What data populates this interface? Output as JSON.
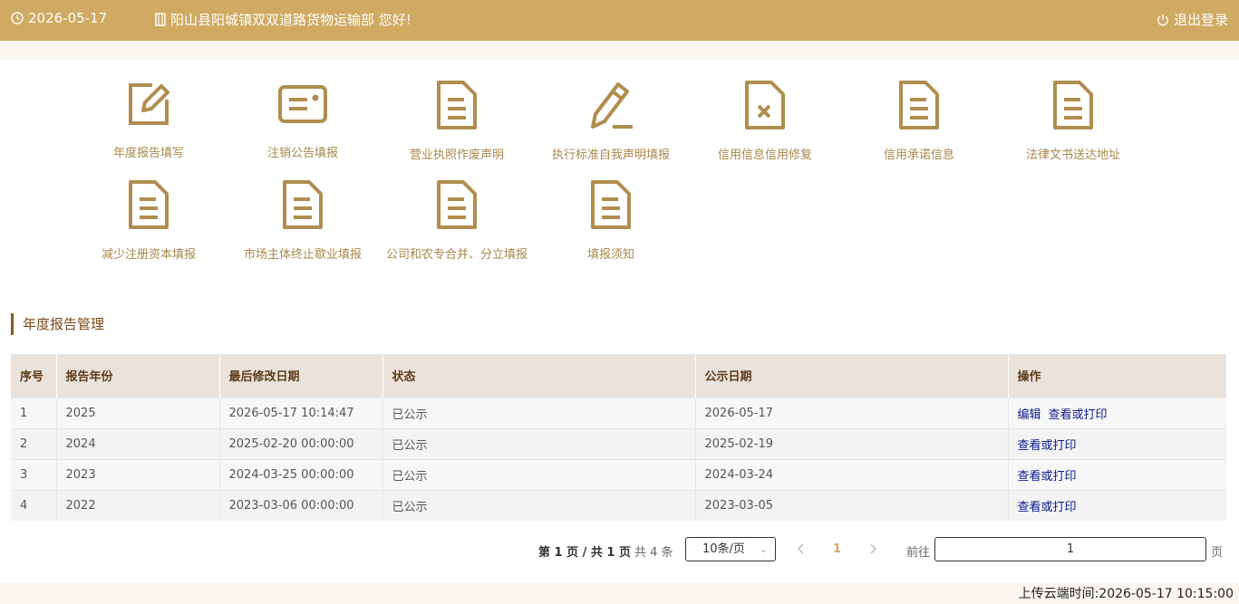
{
  "header": {
    "date": "2026-05-17",
    "greeting": "阳山县阳城镇双双道路货物运输部 您好!",
    "logout_label": "退出登录"
  },
  "menu": [
    {
      "label": "年度报告填写",
      "icon": "edit-icon"
    },
    {
      "label": "注销公告填报",
      "icon": "id-card-icon"
    },
    {
      "label": "营业执照作废声明",
      "icon": "document-icon"
    },
    {
      "label": "执行标准自我声明填报",
      "icon": "pencil-icon"
    },
    {
      "label": "信用信息信用修复",
      "icon": "document-x-icon"
    },
    {
      "label": "信用承诺信息",
      "icon": "document-icon"
    },
    {
      "label": "法律文书送达地址",
      "icon": "document-icon"
    },
    {
      "label": "减少注册资本填报",
      "icon": "document-icon"
    },
    {
      "label": "市场主体终止歇业填报",
      "icon": "document-icon"
    },
    {
      "label": "公司和农专合并、分立填报",
      "icon": "document-icon"
    },
    {
      "label": "填报须知",
      "icon": "document-icon"
    }
  ],
  "section_title": "年度报告管理",
  "table": {
    "columns": [
      "序号",
      "报告年份",
      "最后修改日期",
      "状态",
      "公示日期",
      "操作"
    ],
    "rows": [
      {
        "no": "1",
        "year": "2025",
        "modified": "2026-05-17 10:14:47",
        "status": "已公示",
        "pub_date": "2026-05-17",
        "actions": [
          "编辑",
          "查看或打印"
        ]
      },
      {
        "no": "2",
        "year": "2024",
        "modified": "2025-02-20 00:00:00",
        "status": "已公示",
        "pub_date": "2025-02-19",
        "actions": [
          "查看或打印"
        ]
      },
      {
        "no": "3",
        "year": "2023",
        "modified": "2024-03-25 00:00:00",
        "status": "已公示",
        "pub_date": "2024-03-24",
        "actions": [
          "查看或打印"
        ]
      },
      {
        "no": "4",
        "year": "2022",
        "modified": "2023-03-06 00:00:00",
        "status": "已公示",
        "pub_date": "2023-03-05",
        "actions": [
          "查看或打印"
        ]
      }
    ]
  },
  "pager": {
    "page_info": "第 1 页 / 共 1 页",
    "total": "共 4 条",
    "page_size": "10条/页",
    "current_page": "1",
    "goto_label": "前往",
    "goto_value": "1",
    "page_word": "页"
  },
  "upload_time": "上传云端时间:2026-05-17 10:15:00",
  "colors": {
    "accent": "#d0aa62",
    "icon": "#b08d4f",
    "link": "#0a1c8c"
  }
}
